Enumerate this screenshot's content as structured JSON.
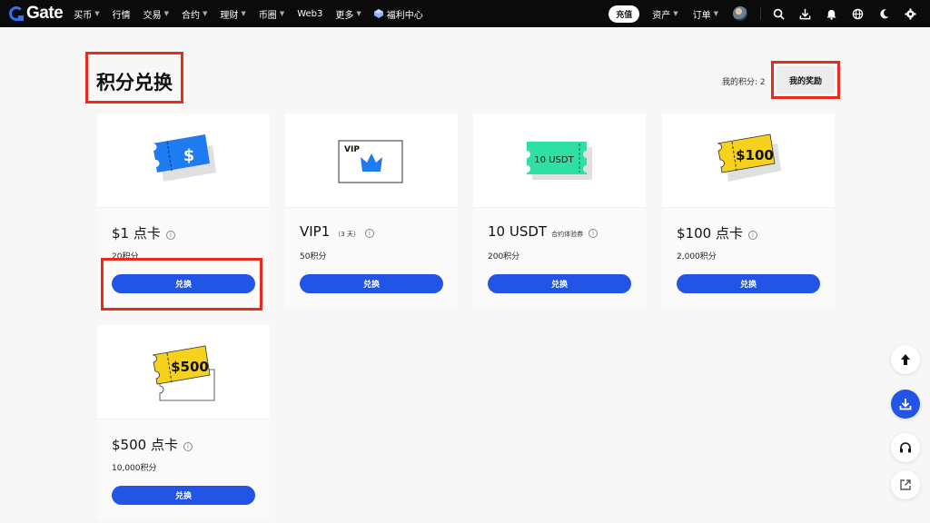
{
  "nav": {
    "logo": "Gate",
    "items": [
      {
        "label": "买币",
        "caret": true
      },
      {
        "label": "行情",
        "caret": false
      },
      {
        "label": "交易",
        "caret": true
      },
      {
        "label": "合约",
        "caret": true
      },
      {
        "label": "理财",
        "caret": true
      },
      {
        "label": "币圈",
        "caret": true
      },
      {
        "label": "Web3",
        "caret": false
      },
      {
        "label": "更多",
        "caret": true
      },
      {
        "label": "福利中心",
        "caret": false
      }
    ],
    "deposit": "充值",
    "assets": "资产",
    "orders": "订单",
    "icons": [
      "search-icon",
      "download-icon",
      "bell-icon",
      "globe-icon",
      "moon-icon",
      "gear-icon"
    ]
  },
  "header": {
    "title": "积分兑换",
    "points_label": "我的积分: 2",
    "rewards_button": "我的奖励"
  },
  "cards": [
    {
      "name": "$1 点卡",
      "sub": "",
      "price": "20积分",
      "button": "兑换",
      "image_text": "$"
    },
    {
      "name": "VIP1",
      "sub": "（3 天）",
      "price": "50积分",
      "button": "兑换",
      "image_text": "VIP"
    },
    {
      "name": "10 USDT",
      "sub": "合约体验券",
      "price": "200积分",
      "button": "兑换",
      "image_text": "10 USDT"
    },
    {
      "name": "$100 点卡",
      "sub": "",
      "price": "2,000积分",
      "button": "兑换",
      "image_text": "$100"
    },
    {
      "name": "$500 点卡",
      "sub": "",
      "price": "10,000积分",
      "button": "兑换",
      "image_text": "$500"
    }
  ],
  "colors": {
    "accent": "#2255e6",
    "highlight": "#e82b1a",
    "ticket_blue": "#1e7bf0",
    "ticket_green": "#2ee0a6",
    "ticket_yellow": "#f7d21c"
  }
}
